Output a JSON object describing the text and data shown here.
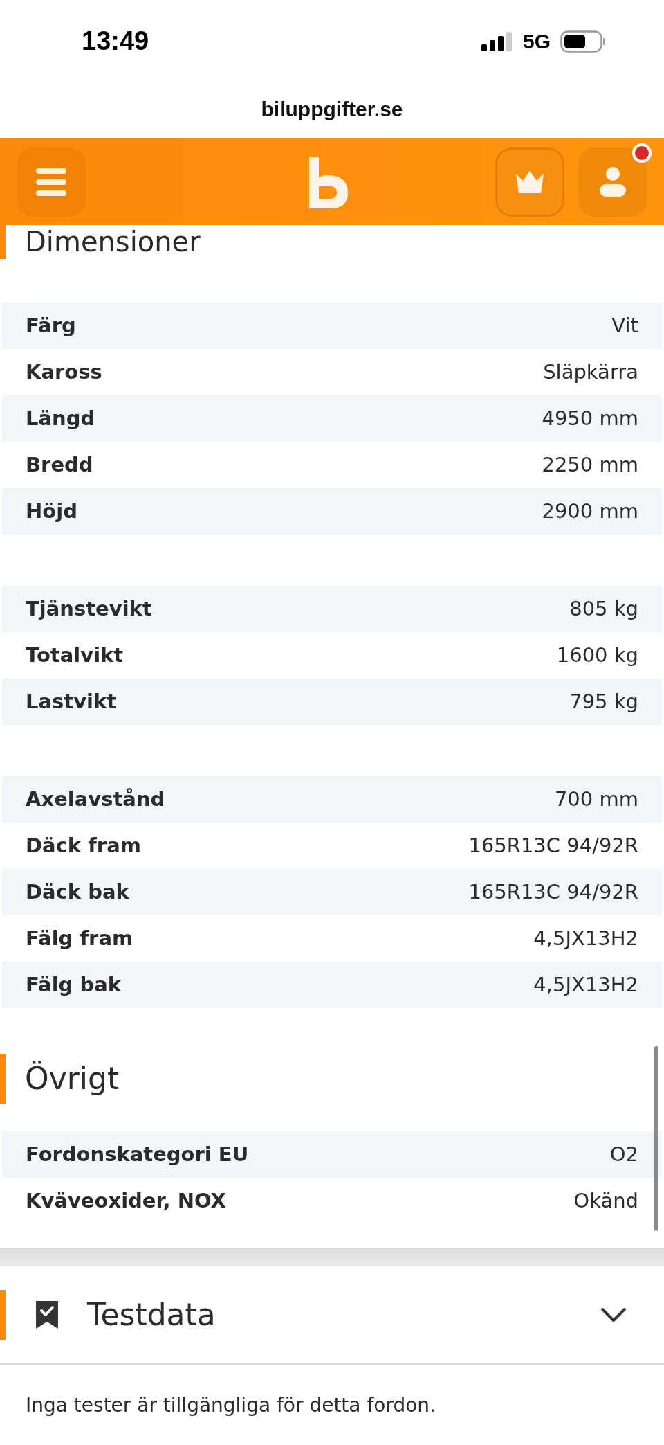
{
  "status_bar": {
    "time": "13:49",
    "network": "5G"
  },
  "browser": {
    "url": "biluppgifter.se"
  },
  "header": {
    "notification": true
  },
  "sections": [
    {
      "title": "Dimensioner",
      "groups": [
        [
          {
            "label": "Färg",
            "value": "Vit"
          },
          {
            "label": "Kaross",
            "value": "Släpkärra"
          },
          {
            "label": "Längd",
            "value": "4950 mm"
          },
          {
            "label": "Bredd",
            "value": "2250 mm"
          },
          {
            "label": "Höjd",
            "value": "2900 mm"
          }
        ],
        [
          {
            "label": "Tjänstevikt",
            "value": "805 kg"
          },
          {
            "label": "Totalvikt",
            "value": "1600 kg"
          },
          {
            "label": "Lastvikt",
            "value": "795 kg"
          }
        ],
        [
          {
            "label": "Axelavstånd",
            "value": "700 mm"
          },
          {
            "label": "Däck fram",
            "value": "165R13C 94/92R"
          },
          {
            "label": "Däck bak",
            "value": "165R13C 94/92R"
          },
          {
            "label": "Fälg fram",
            "value": "4,5JX13H2"
          },
          {
            "label": "Fälg bak",
            "value": "4,5JX13H2"
          }
        ]
      ]
    },
    {
      "title": "Övrigt",
      "groups": [
        [
          {
            "label": "Fordonskategori EU",
            "value": "O2"
          },
          {
            "label": "Kväveoxider, NOX",
            "value": "Okänd"
          }
        ]
      ]
    }
  ],
  "testdata": {
    "title": "Testdata",
    "message": "Inga tester är tillgängliga för detta fordon."
  }
}
